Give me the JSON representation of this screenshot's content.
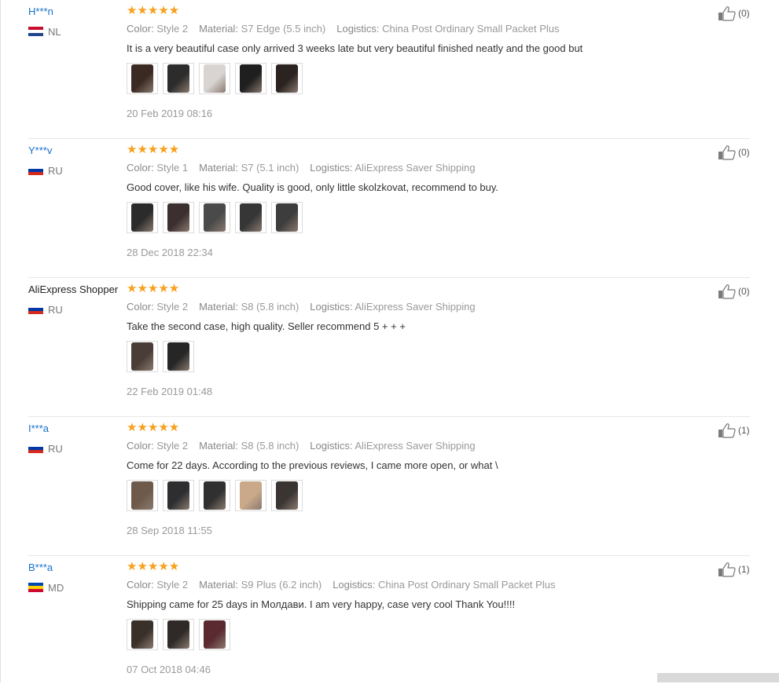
{
  "labels": {
    "color": "Color",
    "material": "Material",
    "logistics": "Logistics"
  },
  "reviews": [
    {
      "user": "H***n",
      "country": "NL",
      "flag_colors": [
        "#c8102e",
        "#ffffff",
        "#21468b"
      ],
      "stars": "★★★★★",
      "color": "Style 2",
      "material": "S7 Edge (5.5 inch)",
      "logistics": "China Post Ordinary Small Packet Plus",
      "text": "It is a very beautiful case only arrived 3 weeks late but very beautiful finished neatly and the good but",
      "photos": [
        "#3a2a22",
        "#2c2c2c",
        "#d8d4d2",
        "#1f1f1f",
        "#2a2320"
      ],
      "date": "20 Feb 2019 08:16",
      "likes": "(0)"
    },
    {
      "user": "Y***v",
      "country": "RU",
      "flag_colors": [
        "#ffffff",
        "#0039a6",
        "#d52b1e"
      ],
      "stars": "★★★★★",
      "color": "Style 1",
      "material": "S7 (5.1 inch)",
      "logistics": "AliExpress Saver Shipping",
      "text": "Good cover, like his wife. Quality is good, only little skolzkovat, recommend to buy.",
      "photos": [
        "#2b2b2b",
        "#3b2f2f",
        "#4a4a4a",
        "#363636",
        "#3d3d3d"
      ],
      "date": "28 Dec 2018 22:34",
      "likes": "(0)"
    },
    {
      "user": "AliExpress Shopper",
      "country": "RU",
      "flag_colors": [
        "#ffffff",
        "#0039a6",
        "#d52b1e"
      ],
      "stars": "★★★★★",
      "color": "Style 2",
      "material": "S8 (5.8 inch)",
      "logistics": "AliExpress Saver Shipping",
      "text": "Take the second case, high quality. Seller recommend 5 + + +",
      "photos": [
        "#4a3c36",
        "#262626"
      ],
      "date": "22 Feb 2019 01:48",
      "likes": "(0)"
    },
    {
      "user": "I***a",
      "country": "RU",
      "flag_colors": [
        "#ffffff",
        "#0039a6",
        "#d52b1e"
      ],
      "stars": "★★★★★",
      "color": "Style 2",
      "material": "S8 (5.8 inch)",
      "logistics": "AliExpress Saver Shipping",
      "text": "Come for 22 days. According to the previous reviews, I came more open, or what \\",
      "photos": [
        "#6d5a4a",
        "#2e2e30",
        "#303030",
        "#c9a98a",
        "#3a3432"
      ],
      "date": "28 Sep 2018 11:55",
      "likes": "(1)"
    },
    {
      "user": "B***a",
      "country": "MD",
      "flag_colors": [
        "#0046ae",
        "#ffd200",
        "#cc092f"
      ],
      "stars": "★★★★★",
      "color": "Style 2",
      "material": "S9 Plus (6.2 inch)",
      "logistics": "China Post Ordinary Small Packet Plus",
      "text": "Shipping came for 25 days in Молдави. I am very happy, case very cool Thank You!!!!",
      "photos": [
        "#3a302a",
        "#2f2a28",
        "#5a2a30"
      ],
      "date": "07 Oct 2018 04:46",
      "likes": "(1)"
    }
  ]
}
